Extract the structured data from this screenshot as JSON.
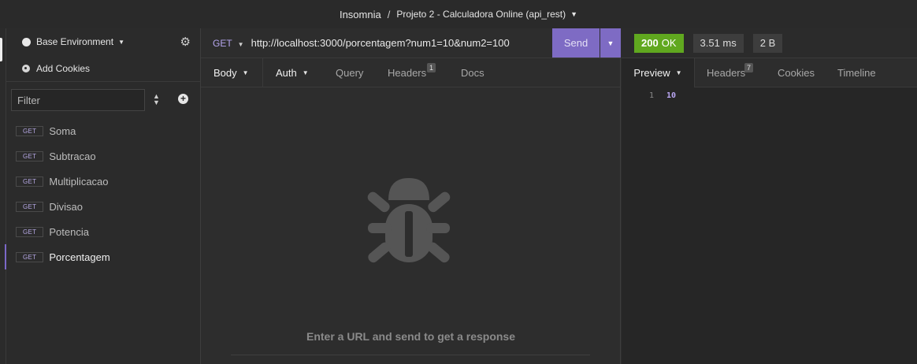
{
  "titlebar": {
    "app": "Insomnia",
    "separator": "/",
    "project": "Projeto 2 - Calculadora Online (api_rest)"
  },
  "sidebar": {
    "environment": "Base Environment",
    "add_cookies": "Add Cookies",
    "filter_placeholder": "Filter",
    "requests": [
      {
        "method": "GET",
        "name": "Soma"
      },
      {
        "method": "GET",
        "name": "Subtracao"
      },
      {
        "method": "GET",
        "name": "Multiplicacao"
      },
      {
        "method": "GET",
        "name": "Divisao"
      },
      {
        "method": "GET",
        "name": "Potencia"
      },
      {
        "method": "GET",
        "name": "Porcentagem",
        "active": true
      }
    ]
  },
  "request": {
    "method": "GET",
    "url": "http://localhost:3000/porcentagem?num1=10&num2=100",
    "send_label": "Send",
    "tabs": {
      "body": "Body",
      "auth": "Auth",
      "query": "Query",
      "headers": "Headers",
      "headers_count": "1",
      "docs": "Docs"
    },
    "empty_message": "Enter a URL and send to get a response"
  },
  "response": {
    "status_code": "200",
    "status_text": "OK",
    "time": "3.51 ms",
    "size": "2 B",
    "tabs": {
      "preview": "Preview",
      "headers": "Headers",
      "headers_count": "7",
      "cookies": "Cookies",
      "timeline": "Timeline"
    },
    "lines": [
      {
        "number": "1",
        "content": "10"
      }
    ]
  },
  "colors": {
    "accent": "#7e6bc4",
    "ok": "#60a81f",
    "method": "#b7a9e6"
  },
  "icons": [
    "gear-icon",
    "cookie-icon",
    "sort-icon",
    "plus-circle-icon",
    "bug-icon",
    "chevron-down-icon"
  ]
}
